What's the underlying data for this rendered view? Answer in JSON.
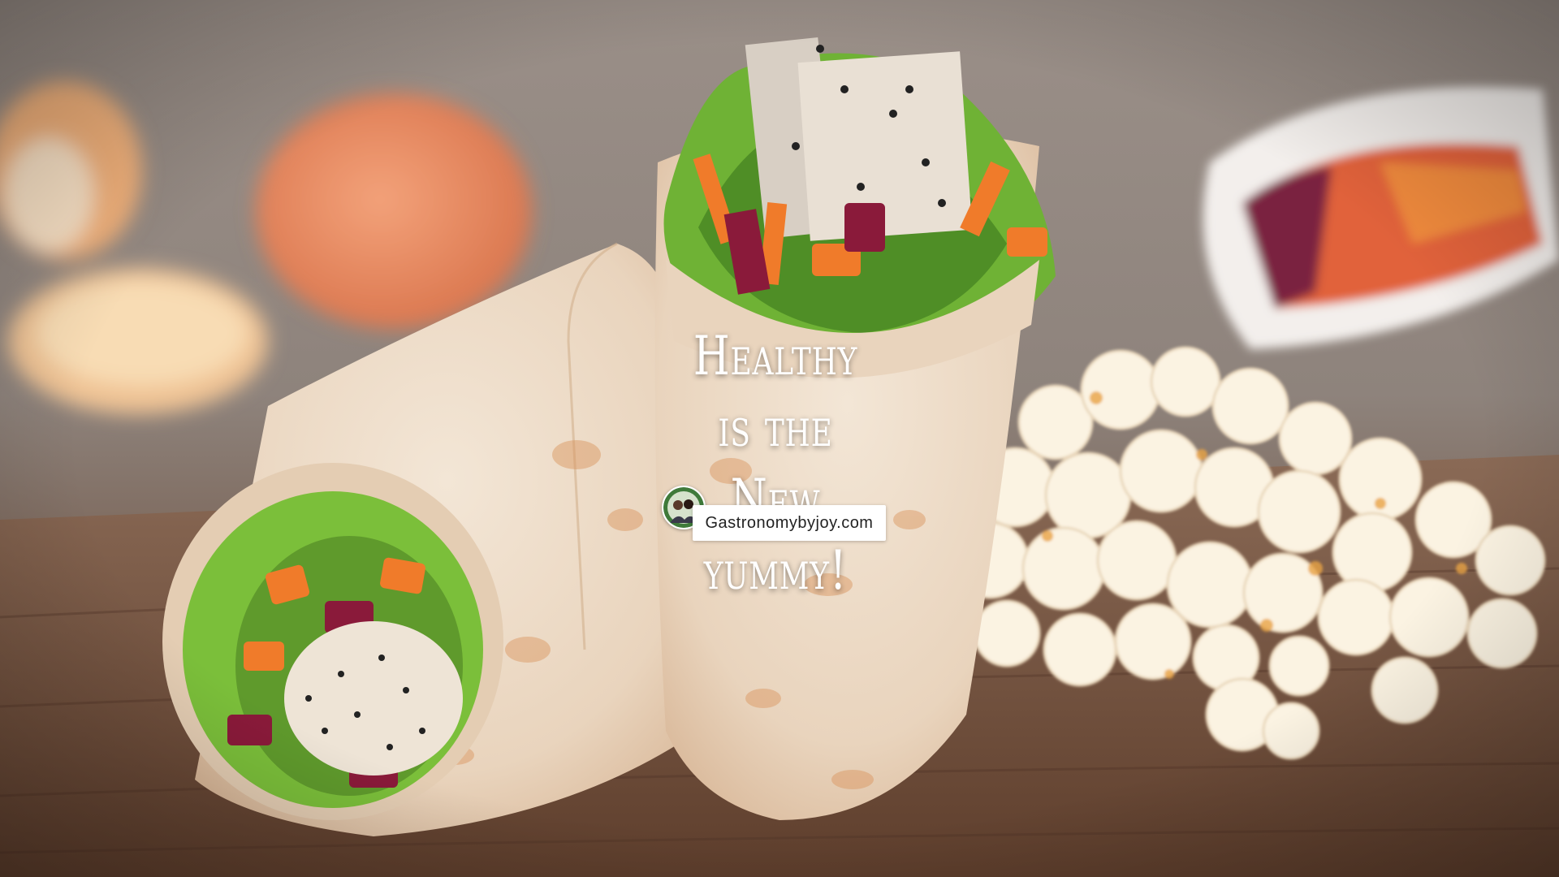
{
  "overlay": {
    "line1": "Healthy is the",
    "line2": "New yummy!"
  },
  "badge": {
    "site": "Gastronomybyjoy.com",
    "avatar_icon": "author-photo-avatar"
  },
  "colors": {
    "tortilla": "#ecd9c2",
    "lettuce": "#7bbf3a",
    "carrot": "#f07b2a",
    "beet": "#8a1a3a",
    "popcorn": "#fbf3e2",
    "wood": "#7a5a45"
  }
}
